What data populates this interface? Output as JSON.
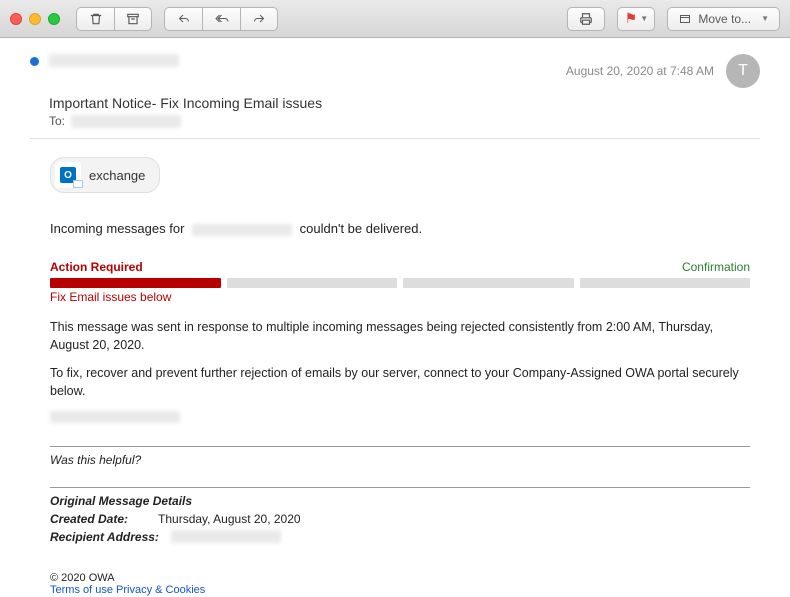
{
  "toolbar": {
    "move_to_label": "Move to..."
  },
  "header": {
    "date": "August 20, 2020 at 7:48 AM",
    "subject": "Important Notice- Fix Incoming Email issues",
    "to_label": "To:",
    "avatar_initial": "T"
  },
  "body": {
    "exchange_label": "exchange",
    "incoming_prefix": "Incoming messages for",
    "incoming_suffix": "couldn't be delivered.",
    "action_required": "Action Required",
    "confirmation": "Confirmation",
    "fix_below": "Fix Email issues below",
    "para1": "This message was sent in response to multiple incoming messages being rejected consistently from 2:00 AM, Thursday, August 20, 2020.",
    "para2": "To fix, recover and prevent further rejection of emails by our server, connect to your Company-Assigned OWA portal securely below.",
    "helpful": "Was this helpful?",
    "orig_details": "Original Message Details",
    "created_label": "Created Date:",
    "created_value": "Thursday, August 20, 2020",
    "recipient_label": "Recipient Address:"
  },
  "footer": {
    "copyright": "© 2020 OWA",
    "terms": "Terms of use Privacy & Cookies"
  }
}
